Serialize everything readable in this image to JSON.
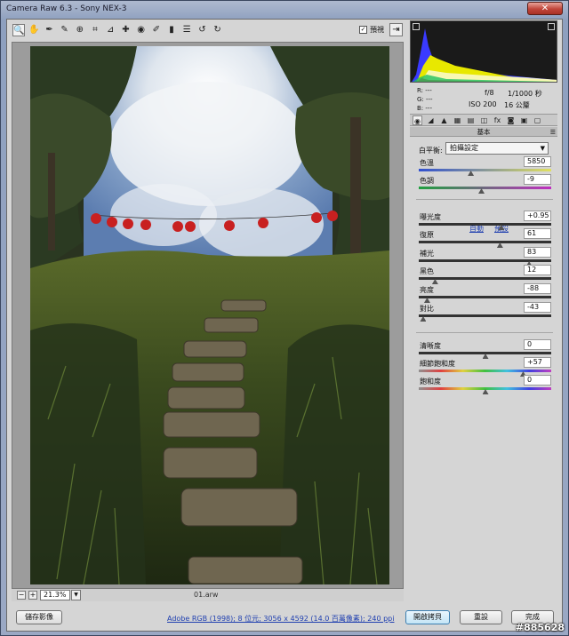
{
  "window": {
    "title": "Camera Raw 6.3  -  Sony NEX-3",
    "close_glyph": "✕"
  },
  "toolbar": {
    "tools": [
      {
        "name": "zoom-tool-icon",
        "glyph": "🔍"
      },
      {
        "name": "hand-tool-icon",
        "glyph": "✋"
      },
      {
        "name": "white-balance-tool-icon",
        "glyph": "✒"
      },
      {
        "name": "color-sampler-tool-icon",
        "glyph": "✎"
      },
      {
        "name": "target-adjustment-tool-icon",
        "glyph": "⊕"
      },
      {
        "name": "crop-tool-icon",
        "glyph": "⌗"
      },
      {
        "name": "straighten-tool-icon",
        "glyph": "⊿"
      },
      {
        "name": "spot-removal-tool-icon",
        "glyph": "✚"
      },
      {
        "name": "red-eye-tool-icon",
        "glyph": "◉"
      },
      {
        "name": "adjustment-brush-icon",
        "glyph": "✐"
      },
      {
        "name": "graduated-filter-icon",
        "glyph": "▮"
      },
      {
        "name": "preferences-icon",
        "glyph": "☰"
      },
      {
        "name": "rotate-left-icon",
        "glyph": "↺"
      },
      {
        "name": "rotate-right-icon",
        "glyph": "↻"
      }
    ],
    "preview_check": "✓",
    "preview_label": "預視",
    "fullscreen_glyph": "⇥"
  },
  "bottom": {
    "zoom_out": "−",
    "zoom_in": "+",
    "zoom_value": "21.3%",
    "zoom_dropdown": "▼",
    "filename": "01.arw"
  },
  "footer": {
    "save_label": "儲存影像",
    "workflow_link": "Adobe RGB (1998); 8 位元; 3056 x 4592 (14.0 百萬像素); 240 ppi",
    "open_label": "開啟拷貝",
    "reset_label": "重設",
    "done_label": "完成"
  },
  "info": {
    "r": "R:  ---",
    "g": "G:  ---",
    "b": "B:  ---",
    "aperture": "f/8",
    "shutter": "1/1000 秒",
    "iso": "ISO 200",
    "focal": "16 公釐"
  },
  "tabs": [
    {
      "name": "tab-basic-icon",
      "glyph": "◉"
    },
    {
      "name": "tab-tone-curve-icon",
      "glyph": "◢"
    },
    {
      "name": "tab-detail-icon",
      "glyph": "▲"
    },
    {
      "name": "tab-hsl-icon",
      "glyph": "▦"
    },
    {
      "name": "tab-split-toning-icon",
      "glyph": "▤"
    },
    {
      "name": "tab-lens-corrections-icon",
      "glyph": "◫"
    },
    {
      "name": "tab-effects-icon",
      "glyph": "fx"
    },
    {
      "name": "tab-camera-calibration-icon",
      "glyph": "◙"
    },
    {
      "name": "tab-presets-icon",
      "glyph": "▣"
    },
    {
      "name": "tab-snapshots-icon",
      "glyph": "▢"
    }
  ],
  "panel": {
    "title": "基本",
    "menu_glyph": "☰",
    "wb_label": "白平衡:",
    "wb_value": "拍攝設定",
    "wb_arrow": "▼",
    "auto_link": "自動",
    "default_link": "預設"
  },
  "sliders": [
    {
      "label": "色溫",
      "value": "5850",
      "pos": 0.39,
      "track": "temp"
    },
    {
      "label": "色調",
      "value": "-9",
      "pos": 0.47,
      "track": "tint"
    },
    {
      "label": "曝光度",
      "value": "+0.95",
      "pos": 0.62,
      "track": "gray"
    },
    {
      "label": "復原",
      "value": "61",
      "pos": 0.61,
      "track": "gray"
    },
    {
      "label": "補光",
      "value": "83",
      "pos": 0.83,
      "track": "gray"
    },
    {
      "label": "黑色",
      "value": "12",
      "pos": 0.12,
      "track": "gray"
    },
    {
      "label": "亮度",
      "value": "-88",
      "pos": 0.06,
      "track": "gray"
    },
    {
      "label": "對比",
      "value": "-43",
      "pos": 0.03,
      "track": "gray"
    },
    {
      "label": "清晰度",
      "value": "0",
      "pos": 0.5,
      "track": "gray"
    },
    {
      "label": "細節飽和度",
      "value": "+57",
      "pos": 0.785,
      "track": "sat"
    },
    {
      "label": "飽和度",
      "value": "0",
      "pos": 0.5,
      "track": "sat"
    }
  ],
  "watermark": "#885628"
}
